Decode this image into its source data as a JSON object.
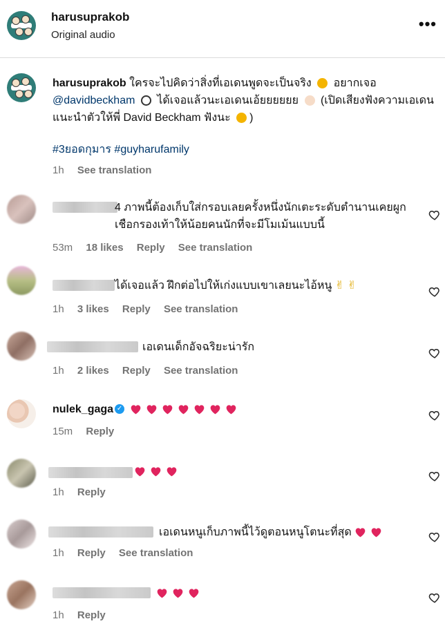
{
  "header": {
    "username": "harusuprakob",
    "subtitle": "Original audio",
    "more_icon": "more-horizontal-icon",
    "more_label": "•••"
  },
  "caption": {
    "username": "harusuprakob",
    "text_1": "ใครจะไปคิดว่าสิ่งที่เอเดนพูดจะเป็นจริง",
    "text_2": "อยากเจอ",
    "mention": "@davidbeckham",
    "text_3": "ได้เจอแล้วนะเอเดนเอ้ยยยยยย",
    "text_4": "(เปิดเสียงฟังความเอเดนแนะนำตัวให้พี่ David Beckham ฟังนะ",
    "text_5": ")",
    "hashtags": "#3ยอดกุมาร #guyharufamily",
    "time": "1h",
    "see_translation": "See translation"
  },
  "comments": [
    {
      "text": "4 ภาพนี้ต้องเก็บใส่กรอบเลยครั้งหนึ่งนักเตะระดับตำนานเคยผูกเชือกรองเท้าให้น้อยคนนักที่จะมีโมเม้นแบบนี้",
      "time": "53m",
      "likes": "18 likes",
      "reply": "Reply",
      "see_translation": "See translation"
    },
    {
      "text": "ได้เจอแล้ว ฝึกต่อไปให้เก่งแบบเขาเลยนะไอ้หนู",
      "emoji": "✌ ✌",
      "time": "1h",
      "likes": "3 likes",
      "reply": "Reply",
      "see_translation": "See translation"
    },
    {
      "text": "เอเดนเด็กอัจฉริยะน่ารัก",
      "time": "1h",
      "likes": "2 likes",
      "reply": "Reply",
      "see_translation": "See translation"
    },
    {
      "username": "nulek_gaga",
      "verified_icon": "verified-badge-icon",
      "hearts": 7,
      "time": "15m",
      "reply": "Reply"
    },
    {
      "hearts": 3,
      "time": "1h",
      "reply": "Reply"
    },
    {
      "text": "เอเดนหนูเก็บภาพนี้ไว้ดูตอนหนูโตนะที่สุด",
      "hearts": 2,
      "time": "1h",
      "reply": "Reply",
      "see_translation": "See translation"
    },
    {
      "hearts": 3,
      "time": "1h",
      "reply": "Reply"
    }
  ],
  "icons": {
    "like": "heart-outline-icon",
    "emoji_heart": "red-heart-icon"
  },
  "colors": {
    "link": "#00376b",
    "meta": "#737373",
    "heart": "#e0245e",
    "verified": "#1d9bf0"
  }
}
